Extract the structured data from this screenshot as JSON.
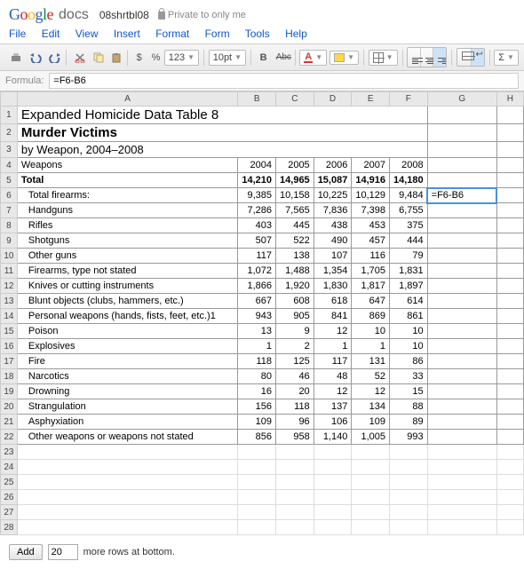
{
  "header": {
    "docs_word": "docs",
    "doc_name": "08shrtbl08",
    "privacy": "Private to only me"
  },
  "menus": [
    "File",
    "Edit",
    "View",
    "Insert",
    "Format",
    "Form",
    "Tools",
    "Help"
  ],
  "toolbar": {
    "currency": "$",
    "percent": "%",
    "numfmt": "123",
    "fontsize": "10pt",
    "bold": "B",
    "strike": "Abc",
    "sigma": "Σ"
  },
  "formula": {
    "label": "Formula:",
    "value": "=F6-B6"
  },
  "columns": [
    "",
    "A",
    "B",
    "C",
    "D",
    "E",
    "F",
    "G",
    "H"
  ],
  "title_rows": {
    "r1": "Expanded Homicide Data Table 8",
    "r2": "Murder Victims",
    "r3": "by Weapon, 2004–2008"
  },
  "header_row": {
    "label": "Weapons",
    "years": [
      "2004",
      "2005",
      "2006",
      "2007",
      "2008"
    ]
  },
  "total_row": {
    "label": "Total",
    "vals": [
      "14,210",
      "14,965",
      "15,087",
      "14,916",
      "14,180"
    ]
  },
  "data_rows": [
    {
      "label": "Total firearms:",
      "vals": [
        "9,385",
        "10,158",
        "10,225",
        "10,129",
        "9,484"
      ]
    },
    {
      "label": "Handguns",
      "vals": [
        "7,286",
        "7,565",
        "7,836",
        "7,398",
        "6,755"
      ]
    },
    {
      "label": "Rifles",
      "vals": [
        "403",
        "445",
        "438",
        "453",
        "375"
      ]
    },
    {
      "label": "Shotguns",
      "vals": [
        "507",
        "522",
        "490",
        "457",
        "444"
      ]
    },
    {
      "label": "Other guns",
      "vals": [
        "117",
        "138",
        "107",
        "116",
        "79"
      ]
    },
    {
      "label": "Firearms, type not stated",
      "vals": [
        "1,072",
        "1,488",
        "1,354",
        "1,705",
        "1,831"
      ]
    },
    {
      "label": "Knives or cutting instruments",
      "vals": [
        "1,866",
        "1,920",
        "1,830",
        "1,817",
        "1,897"
      ]
    },
    {
      "label": "Blunt objects (clubs, hammers, etc.)",
      "vals": [
        "667",
        "608",
        "618",
        "647",
        "614"
      ]
    },
    {
      "label": "Personal weapons (hands, fists, feet, etc.)1",
      "vals": [
        "943",
        "905",
        "841",
        "869",
        "861"
      ]
    },
    {
      "label": "Poison",
      "vals": [
        "13",
        "9",
        "12",
        "10",
        "10"
      ]
    },
    {
      "label": "Explosives",
      "vals": [
        "1",
        "2",
        "1",
        "1",
        "10"
      ]
    },
    {
      "label": "Fire",
      "vals": [
        "118",
        "125",
        "117",
        "131",
        "86"
      ]
    },
    {
      "label": "Narcotics",
      "vals": [
        "80",
        "46",
        "48",
        "52",
        "33"
      ]
    },
    {
      "label": "Drowning",
      "vals": [
        "16",
        "20",
        "12",
        "12",
        "15"
      ]
    },
    {
      "label": "Strangulation",
      "vals": [
        "156",
        "118",
        "137",
        "134",
        "88"
      ]
    },
    {
      "label": "Asphyxiation",
      "vals": [
        "109",
        "96",
        "106",
        "109",
        "89"
      ]
    },
    {
      "label": "Other weapons or weapons not stated",
      "vals": [
        "856",
        "958",
        "1,140",
        "1,005",
        "993"
      ]
    }
  ],
  "selected_cell_value": "=F6-B6",
  "empty_rows": [
    23,
    24,
    25,
    26,
    27,
    28
  ],
  "add_rows": {
    "button": "Add",
    "count": "20",
    "suffix": "more rows at bottom."
  },
  "chart_data": {
    "type": "table",
    "title": "Expanded Homicide Data Table 8 — Murder Victims by Weapon, 2004–2008",
    "columns": [
      "Weapons",
      "2004",
      "2005",
      "2006",
      "2007",
      "2008"
    ],
    "rows": [
      [
        "Total",
        14210,
        14965,
        15087,
        14916,
        14180
      ],
      [
        "Total firearms:",
        9385,
        10158,
        10225,
        10129,
        9484
      ],
      [
        "Handguns",
        7286,
        7565,
        7836,
        7398,
        6755
      ],
      [
        "Rifles",
        403,
        445,
        438,
        453,
        375
      ],
      [
        "Shotguns",
        507,
        522,
        490,
        457,
        444
      ],
      [
        "Other guns",
        117,
        138,
        107,
        116,
        79
      ],
      [
        "Firearms, type not stated",
        1072,
        1488,
        1354,
        1705,
        1831
      ],
      [
        "Knives or cutting instruments",
        1866,
        1920,
        1830,
        1817,
        1897
      ],
      [
        "Blunt objects (clubs, hammers, etc.)",
        667,
        608,
        618,
        647,
        614
      ],
      [
        "Personal weapons (hands, fists, feet, etc.)1",
        943,
        905,
        841,
        869,
        861
      ],
      [
        "Poison",
        13,
        9,
        12,
        10,
        10
      ],
      [
        "Explosives",
        1,
        2,
        1,
        1,
        10
      ],
      [
        "Fire",
        118,
        125,
        117,
        131,
        86
      ],
      [
        "Narcotics",
        80,
        46,
        48,
        52,
        33
      ],
      [
        "Drowning",
        16,
        20,
        12,
        12,
        15
      ],
      [
        "Strangulation",
        156,
        118,
        137,
        134,
        88
      ],
      [
        "Asphyxiation",
        109,
        96,
        106,
        109,
        89
      ],
      [
        "Other weapons or weapons not stated",
        856,
        958,
        1140,
        1005,
        993
      ]
    ]
  }
}
